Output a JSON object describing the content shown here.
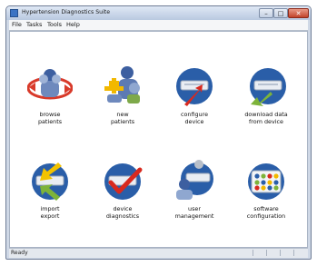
{
  "window": {
    "title": "Hypertension Diagnostics Suite",
    "minimize": "–",
    "maximize": "□",
    "close": "✕"
  },
  "menu": [
    {
      "label": "File"
    },
    {
      "label": "Tasks"
    },
    {
      "label": "Tools"
    },
    {
      "label": "Help"
    }
  ],
  "tiles": [
    {
      "line1": "browse",
      "line2": "patients",
      "icon": "browse-patients-icon"
    },
    {
      "line1": "new",
      "line2": "patients",
      "icon": "new-patients-icon"
    },
    {
      "line1": "configure",
      "line2": "device",
      "icon": "configure-device-icon"
    },
    {
      "line1": "download data",
      "line2": "from device",
      "icon": "download-data-icon"
    },
    {
      "line1": "import",
      "line2": "export",
      "icon": "import-export-icon"
    },
    {
      "line1": "device",
      "line2": "diagnostics",
      "icon": "device-diagnostics-icon"
    },
    {
      "line1": "user",
      "line2": "management",
      "icon": "user-management-icon"
    },
    {
      "line1": "software",
      "line2": "configuration",
      "icon": "software-configuration-icon"
    }
  ],
  "status": {
    "text": "Ready"
  }
}
